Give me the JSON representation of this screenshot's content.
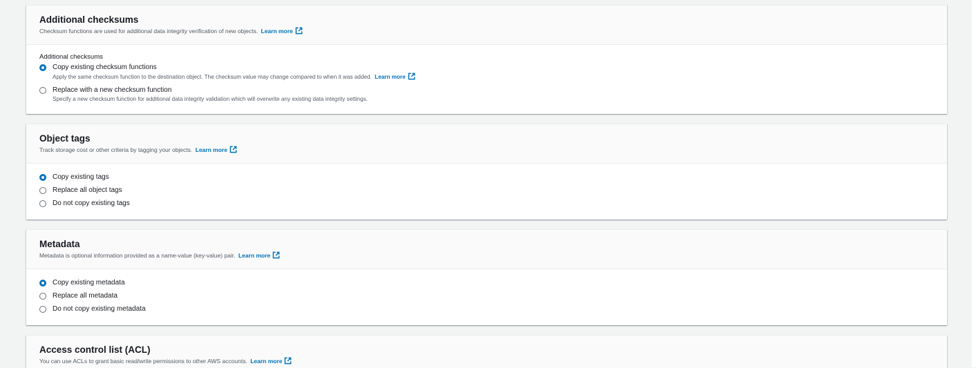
{
  "learn_more": "Learn more",
  "checksums": {
    "title": "Additional checksums",
    "description": "Checksum functions are used for additional data integrity verification of new objects.",
    "field_label": "Additional checksums",
    "options": [
      {
        "label": "Copy existing checksum functions",
        "description": "Apply the same checksum function to the destination object. The checksum value may change compared to when it was added.",
        "has_learn_more": true,
        "checked": true
      },
      {
        "label": "Replace with a new checksum function",
        "description": "Specify a new checksum function for additional data integrity validation which will overwrite any existing data integrity settings.",
        "checked": false
      }
    ]
  },
  "tags": {
    "title": "Object tags",
    "description": "Track storage cost or other criteria by tagging your objects.",
    "options": [
      {
        "label": "Copy existing tags",
        "checked": true
      },
      {
        "label": "Replace all object tags",
        "checked": false
      },
      {
        "label": "Do not copy existing tags",
        "checked": false
      }
    ]
  },
  "metadata": {
    "title": "Metadata",
    "description": "Metadata is optional information provided as a name-value (key-value) pair.",
    "options": [
      {
        "label": "Copy existing metadata",
        "checked": true
      },
      {
        "label": "Replace all metadata",
        "checked": false
      },
      {
        "label": "Do not copy existing metadata",
        "checked": false
      }
    ]
  },
  "acl": {
    "title": "Access control list (ACL)",
    "description": "You can use ACLs to grant basic read/write permissions to other AWS accounts."
  },
  "colors": {
    "accent": "#0073bb",
    "page_bg": "#f2f3f3",
    "header_bg": "#fafafa"
  },
  "icons": {
    "external_link": "external-link-icon",
    "radio_checked": "radio-checked",
    "radio_unchecked": "radio-unchecked"
  }
}
